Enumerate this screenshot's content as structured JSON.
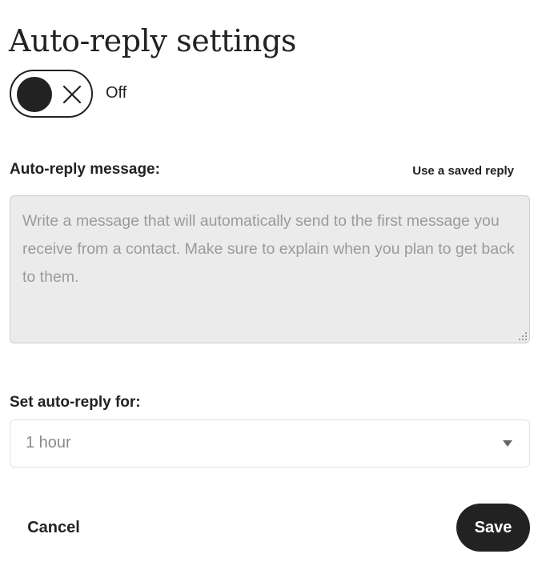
{
  "header": {
    "title": "Auto-reply settings"
  },
  "toggle": {
    "state_label": "Off",
    "is_on": false,
    "icon": "close-icon"
  },
  "message": {
    "label": "Auto-reply message:",
    "saved_reply_link": "Use a saved reply",
    "placeholder": "Write a message that will automatically send to the first message you receive from a contact. Make sure to explain when you plan to get back to them.",
    "value": ""
  },
  "duration": {
    "label": "Set auto-reply for:",
    "selected": "1 hour",
    "icon": "chevron-down-icon"
  },
  "actions": {
    "cancel_label": "Cancel",
    "save_label": "Save"
  },
  "colors": {
    "primary_dark": "#222222",
    "textarea_bg": "#ebebeb",
    "placeholder": "#9b9b9b"
  }
}
